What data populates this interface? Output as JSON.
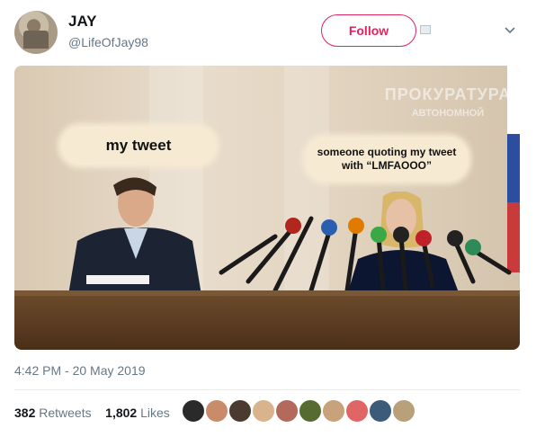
{
  "user": {
    "name": "JAY",
    "handle": "@LifeOfJay98"
  },
  "actions": {
    "follow_label": "Follow"
  },
  "media": {
    "caption_left": "my tweet",
    "caption_right_line1": "someone quoting my tweet",
    "caption_right_line2": "with “LMFAOOO”",
    "sign_line1": "ПРОКУРАТУРА",
    "sign_line2": "АВТОНОМНОЙ"
  },
  "meta": {
    "timestamp": "4:42 PM - 20 May 2019"
  },
  "stats": {
    "retweets_count": "382",
    "retweets_label": "Retweets",
    "likes_count": "1,802",
    "likes_label": "Likes"
  },
  "likers": [
    {
      "color": "#2a2a2a"
    },
    {
      "color": "#c98c6a"
    },
    {
      "color": "#4a3a30"
    },
    {
      "color": "#d9b38c"
    },
    {
      "color": "#b36a5c"
    },
    {
      "color": "#556b2f"
    },
    {
      "color": "#c7a27a"
    },
    {
      "color": "#e06666"
    },
    {
      "color": "#3c5a7a"
    },
    {
      "color": "#b8a07a"
    }
  ],
  "icons": {
    "chevron": "chevron-down-icon",
    "photo": "image-placeholder-icon"
  }
}
